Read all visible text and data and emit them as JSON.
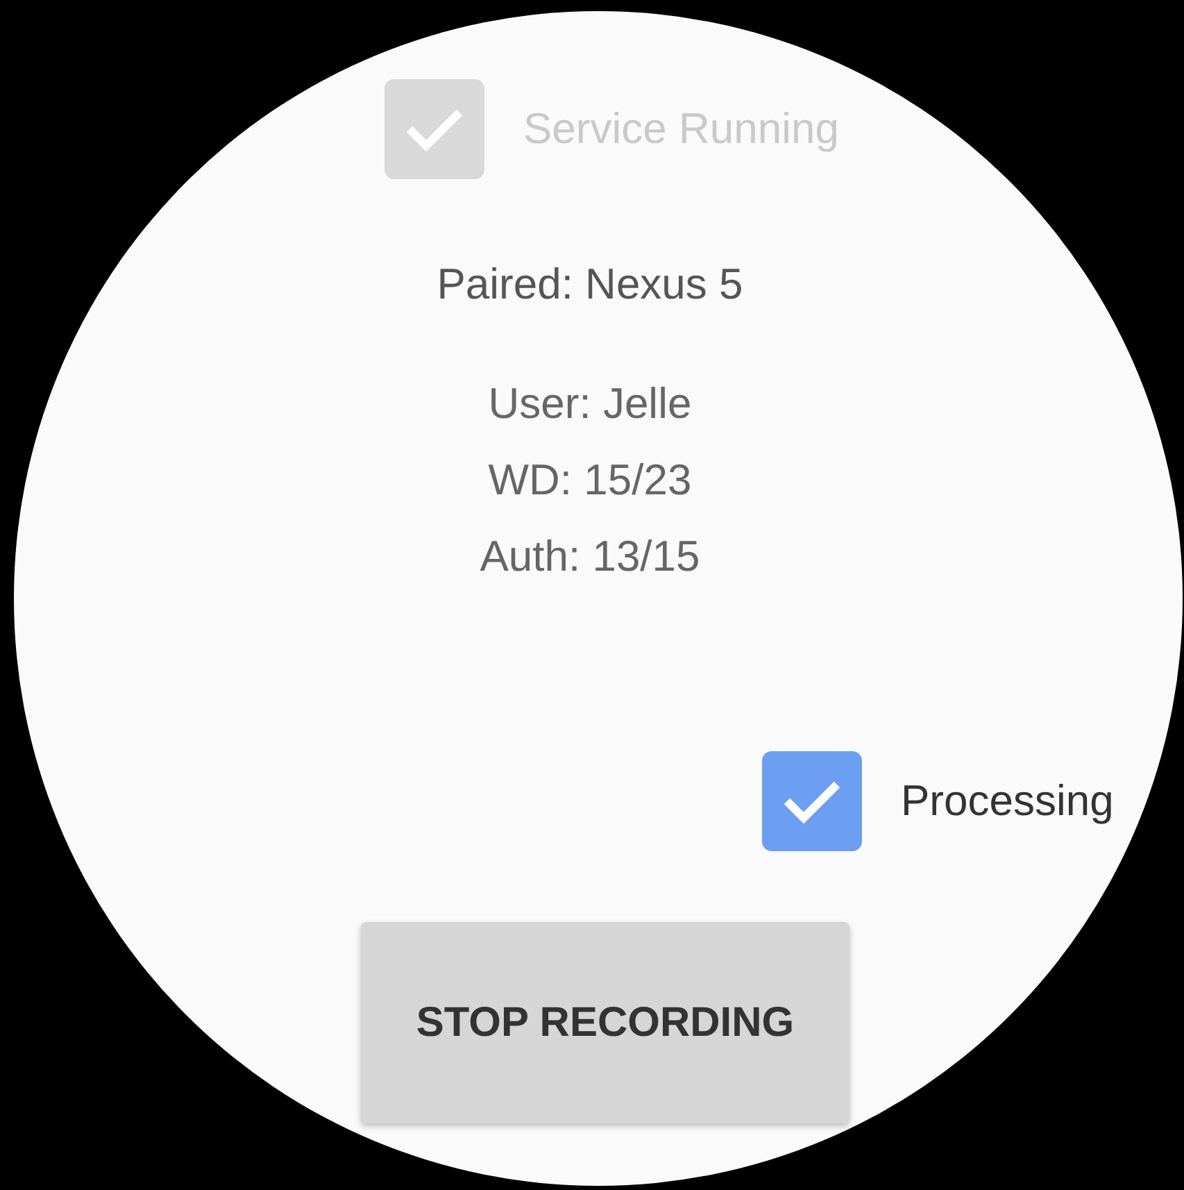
{
  "service": {
    "label": "Service Running",
    "checked": true,
    "disabled": true
  },
  "paired": "Paired: Nexus 5",
  "info_lines": [
    "User: Jelle",
    "WD: 15/23",
    "Auth: 13/15"
  ],
  "processing": {
    "label": "Processing",
    "checked": true,
    "disabled": false
  },
  "button": {
    "label": "STOP RECORDING"
  }
}
